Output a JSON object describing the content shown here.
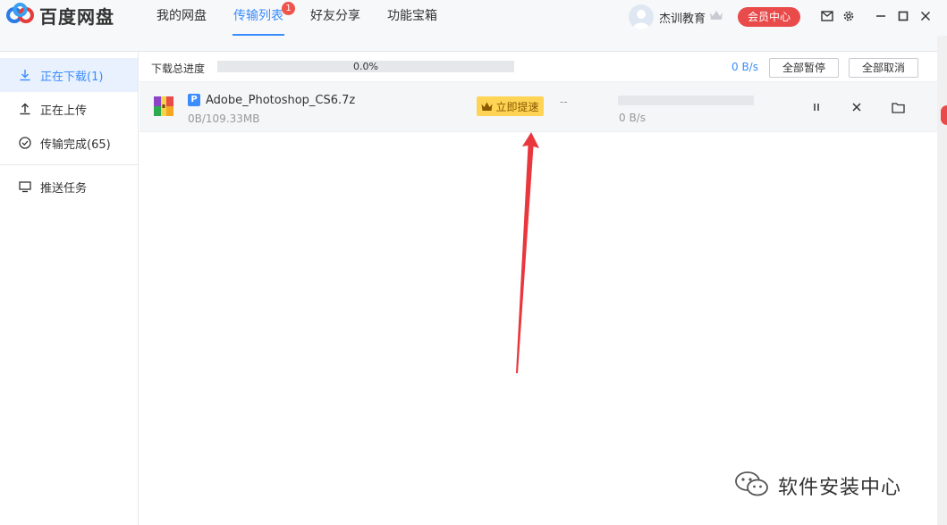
{
  "app": {
    "title": "百度网盘"
  },
  "nav": [
    {
      "label": "我的网盘"
    },
    {
      "label": "传输列表",
      "badge": "1"
    },
    {
      "label": "好友分享"
    },
    {
      "label": "功能宝箱"
    }
  ],
  "user": {
    "name": "杰训教育",
    "vip_label": "会员中心"
  },
  "sidebar": {
    "items": [
      {
        "label": "正在下载(1)"
      },
      {
        "label": "正在上传"
      },
      {
        "label": "传输完成(65)"
      },
      {
        "label": "推送任务"
      }
    ]
  },
  "progress": {
    "label": "下载总进度",
    "percent_text": "0.0%",
    "percent": 0,
    "speed": "0 B/s",
    "pause_all_label": "全部暂停",
    "cancel_all_label": "全部取消"
  },
  "download": {
    "badge": "P",
    "file_name": "Adobe_Photoshop_CS6.7z",
    "size_text": "0B/109.33MB",
    "boost_label": "立即提速",
    "eta": "--",
    "speed": "0 B/s",
    "progress": 0
  },
  "watermark": {
    "text": "软件安装中心"
  },
  "colors": {
    "accent": "#3b8cff",
    "vip": "#e94a4a",
    "boost": "#ffd454",
    "arrow": "#e8373d"
  }
}
